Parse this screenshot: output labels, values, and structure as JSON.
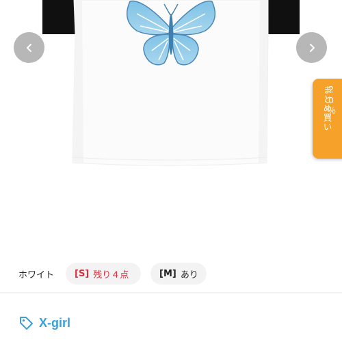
{
  "product": {
    "color_label": "ホワイト",
    "sizes": [
      {
        "size": "[S]",
        "stock": "残り４点",
        "color": "#d8303e"
      },
      {
        "size": "[M]",
        "stock": "あり",
        "color": "#222222"
      }
    ],
    "brand": "X-girl",
    "brand_color": "#3aa0d8"
  },
  "promo_tab": {
    "line1": "まとめ買い",
    "line2": "20％",
    "color": "#f5a12a"
  },
  "gallery": {
    "prev_icon": "chevron-left-icon",
    "next_icon": "chevron-right-icon"
  }
}
